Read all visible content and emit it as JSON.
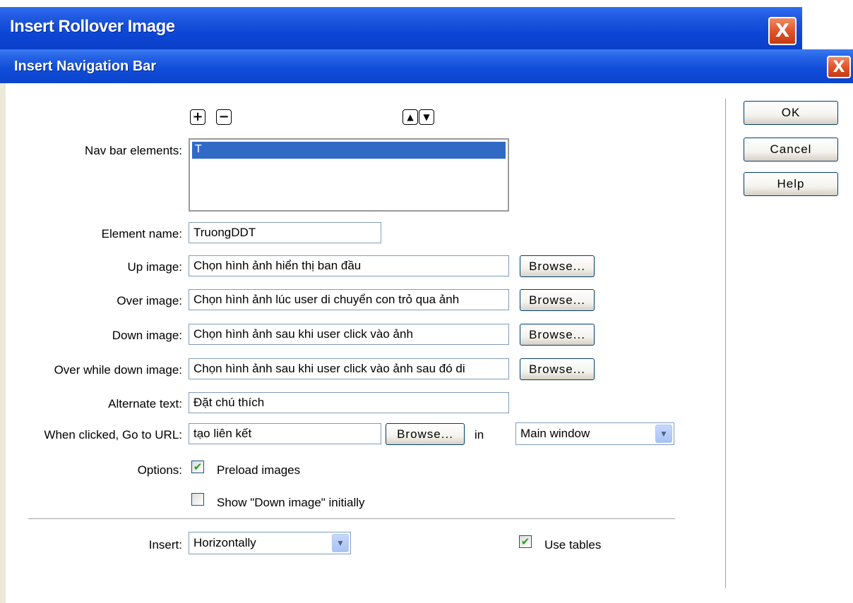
{
  "back_window": {
    "title": "Insert Rollover Image",
    "close_glyph": "X"
  },
  "dialog": {
    "title": "Insert Navigation Bar",
    "close_glyph": "X"
  },
  "element_controls": {
    "add_glyph": "+",
    "remove_glyph": "−",
    "move_up_glyph": "▲",
    "move_down_glyph": "▼"
  },
  "nav_bar_elements": {
    "label": "Nav bar elements:",
    "items": [
      "T"
    ]
  },
  "fields": {
    "element_name": {
      "label": "Element name:",
      "value": "TruongDDT"
    },
    "up_image": {
      "label": "Up image:",
      "value": "Chọn hình ảnh hiển thị ban đầu"
    },
    "over_image": {
      "label": "Over image:",
      "value": "Chọn hình ảnh lúc user di chuyển con trỏ qua ảnh"
    },
    "down_image": {
      "label": "Down image:",
      "value": "Chọn hình ảnh sau khi user click vào ảnh"
    },
    "over_while_down_image": {
      "label": "Over while down image:",
      "value": "Chọn hình ảnh sau khi user click vào ảnh sau đó di"
    },
    "alternate_text": {
      "label": "Alternate text:",
      "value": "Đặt chú thích"
    },
    "go_to_url": {
      "label": "When clicked, Go to URL:",
      "value": "tạo liên kết",
      "in_label": "in",
      "target": "Main window"
    }
  },
  "browse_label": "Browse...",
  "options": {
    "label": "Options:",
    "preload_images": {
      "label": "Preload images",
      "checked": true
    },
    "show_down_image": {
      "label": "Show \"Down image\" initially",
      "checked": false
    }
  },
  "insert": {
    "label": "Insert:",
    "value": "Horizontally",
    "use_tables": {
      "label": "Use tables",
      "checked": true
    }
  },
  "buttons": {
    "ok": "OK",
    "cancel": "Cancel",
    "help": "Help"
  },
  "check_glyph": "✔",
  "dropdown_glyph": "▼"
}
